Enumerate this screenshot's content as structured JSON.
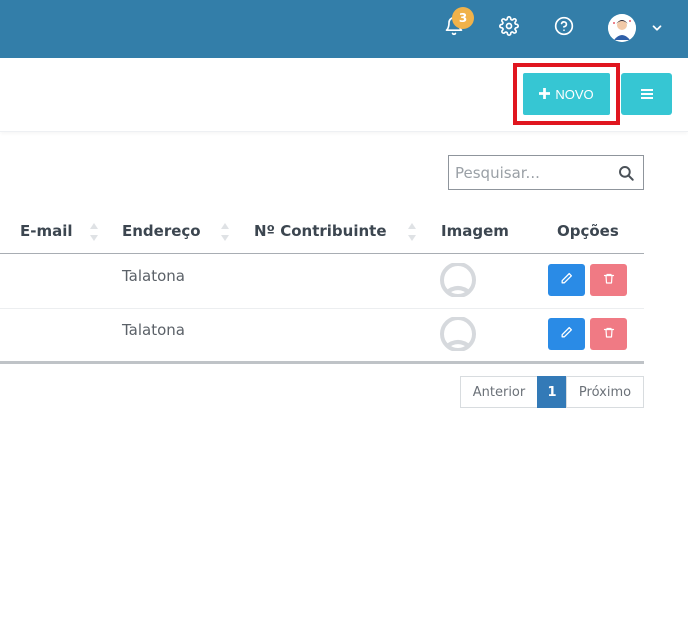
{
  "topbar": {
    "notifications": {
      "icon": "bell-icon",
      "count": "3"
    },
    "settings": {
      "icon": "gear-icon"
    },
    "help": {
      "icon": "question-circle-icon"
    },
    "user": {
      "icon": "avatar",
      "menu_icon": "chevron-down-icon"
    }
  },
  "actions": {
    "new_label": "NOVO",
    "new_icon": "plus-icon",
    "menu_icon": "hamburger-menu-icon"
  },
  "search": {
    "placeholder": "Pesquisar...",
    "icon": "search-icon"
  },
  "table": {
    "columns": [
      {
        "label": "E-mail",
        "sortable": true
      },
      {
        "label": "Endereço",
        "sortable": true
      },
      {
        "label": "Nº Contribuinte",
        "sortable": true
      },
      {
        "label": "Imagem",
        "sortable": false
      },
      {
        "label": "Opções",
        "sortable": false
      }
    ],
    "rows": [
      {
        "email": "",
        "address": "Talatona",
        "taxpayer": "",
        "image": "user-placeholder-icon"
      },
      {
        "email": "",
        "address": "Talatona",
        "taxpayer": "",
        "image": "user-placeholder-icon"
      }
    ],
    "row_actions": {
      "edit_icon": "pencil-icon",
      "delete_icon": "trash-icon"
    }
  },
  "pagination": {
    "previous": "Anterior",
    "current": "1",
    "next": "Próximo"
  },
  "colors": {
    "topbar": "#337ea9",
    "primary_action": "#36c6d3",
    "highlight": "#e0161f",
    "edit": "#2a8be6",
    "delete": "#f07a84",
    "badge": "#f0b24a",
    "page_active": "#337ab7"
  }
}
